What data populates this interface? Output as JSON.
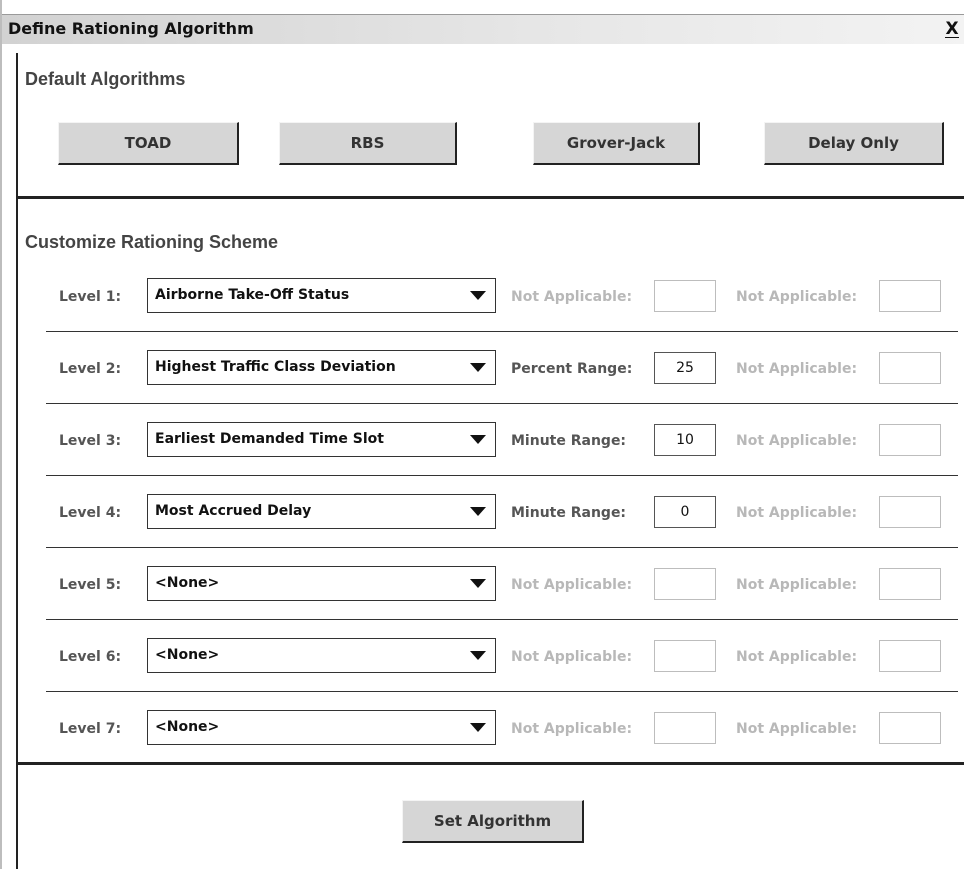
{
  "window": {
    "title": "Define Rationing Algorithm",
    "close_label": "X"
  },
  "defaults": {
    "title": "Default Algorithms",
    "buttons": [
      "TOAD",
      "RBS",
      "Grover-Jack",
      "Delay Only"
    ]
  },
  "customize": {
    "title": "Customize Rationing Scheme",
    "levels": [
      {
        "label": "Level 1:",
        "criterion": "Airborne Take-Off Status",
        "param1_label": "Not Applicable:",
        "param1_value": "",
        "param1_enabled": false,
        "param2_label": "Not Applicable:",
        "param2_value": "",
        "param2_enabled": false
      },
      {
        "label": "Level 2:",
        "criterion": "Highest Traffic Class Deviation",
        "param1_label": "Percent Range:",
        "param1_value": "25",
        "param1_enabled": true,
        "param2_label": "Not Applicable:",
        "param2_value": "",
        "param2_enabled": false
      },
      {
        "label": "Level 3:",
        "criterion": "Earliest Demanded Time Slot",
        "param1_label": "Minute Range:",
        "param1_value": "10",
        "param1_enabled": true,
        "param2_label": "Not Applicable:",
        "param2_value": "",
        "param2_enabled": false
      },
      {
        "label": "Level 4:",
        "criterion": "Most Accrued Delay",
        "param1_label": "Minute Range:",
        "param1_value": "0",
        "param1_enabled": true,
        "param2_label": "Not Applicable:",
        "param2_value": "",
        "param2_enabled": false
      },
      {
        "label": "Level 5:",
        "criterion": "<None>",
        "param1_label": "Not Applicable:",
        "param1_value": "",
        "param1_enabled": false,
        "param2_label": "Not Applicable:",
        "param2_value": "",
        "param2_enabled": false
      },
      {
        "label": "Level 6:",
        "criterion": "<None>",
        "param1_label": "Not Applicable:",
        "param1_value": "",
        "param1_enabled": false,
        "param2_label": "Not Applicable:",
        "param2_value": "",
        "param2_enabled": false
      },
      {
        "label": "Level 7:",
        "criterion": "<None>",
        "param1_label": "Not Applicable:",
        "param1_value": "",
        "param1_enabled": false,
        "param2_label": "Not Applicable:",
        "param2_value": "",
        "param2_enabled": false
      }
    ]
  },
  "footer": {
    "set_button": "Set Algorithm"
  }
}
